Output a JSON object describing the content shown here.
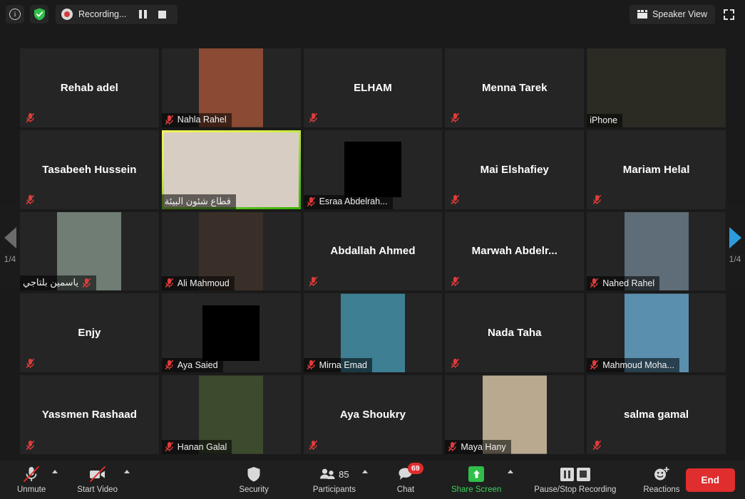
{
  "topbar": {
    "info_icon": "info-icon",
    "shield_icon": "shield-icon",
    "recording_label": "Recording...",
    "pause_recording_icon": "pause-icon",
    "stop_recording_icon": "stop-icon",
    "view_button_label": "Speaker View",
    "view_icon": "grid-view-icon",
    "fullscreen_icon": "fullscreen-icon"
  },
  "gallery": {
    "prev_page_label": "1/4",
    "next_page_label": "1/4",
    "prev_icon": "chevron-left-icon",
    "next_icon": "chevron-right-icon",
    "mute_icon": "microphone-muted-icon",
    "participants": [
      {
        "name": "Rehab adel",
        "video": false,
        "muted": true,
        "name_position": "center"
      },
      {
        "name": "Nahla Rahel",
        "video": true,
        "muted": true,
        "name_position": "bar",
        "avatar": "#8a4a33"
      },
      {
        "name": "ELHAM",
        "video": false,
        "muted": true,
        "name_position": "center"
      },
      {
        "name": "Menna Tarek",
        "video": false,
        "muted": true,
        "name_position": "center"
      },
      {
        "name": "iPhone",
        "video": true,
        "muted": false,
        "name_position": "bar",
        "avatar": "#2b2b24",
        "wide": true
      },
      {
        "name": "Tasabeeh Hussein",
        "video": false,
        "muted": true,
        "name_position": "center"
      },
      {
        "name": "قطاع شئون البيئة",
        "video": true,
        "muted": false,
        "name_position": "bar",
        "active": true,
        "rtl": true,
        "avatar": "#d8cdc2",
        "wide": true
      },
      {
        "name": "Esraa Abdelrah...",
        "video": true,
        "muted": true,
        "name_position": "bar",
        "avatar": "#000000",
        "black": true
      },
      {
        "name": "Mai Elshafiey",
        "video": false,
        "muted": true,
        "name_position": "center"
      },
      {
        "name": "Mariam Helal",
        "video": false,
        "muted": true,
        "name_position": "center"
      },
      {
        "name": "ياسمين بلتاجي",
        "video": true,
        "muted": true,
        "name_position": "bar",
        "rtl": true,
        "avatar": "#6f7d74"
      },
      {
        "name": "Ali Mahmoud",
        "video": true,
        "muted": true,
        "name_position": "bar",
        "avatar": "#3a2f28"
      },
      {
        "name": "Abdallah Ahmed",
        "video": false,
        "muted": true,
        "name_position": "center"
      },
      {
        "name": "Marwah  Abdelr...",
        "video": false,
        "muted": true,
        "name_position": "center"
      },
      {
        "name": "Nahed Rahel",
        "video": true,
        "muted": true,
        "name_position": "bar",
        "avatar": "#5e6d78"
      },
      {
        "name": "Enjy",
        "video": false,
        "muted": true,
        "name_position": "center"
      },
      {
        "name": "Aya Saied",
        "video": true,
        "muted": true,
        "name_position": "bar",
        "avatar": "#000000",
        "black": true
      },
      {
        "name": "Mirna Emad",
        "video": true,
        "muted": true,
        "name_position": "bar",
        "avatar": "#3f7f94"
      },
      {
        "name": "Nada Taha",
        "video": false,
        "muted": true,
        "name_position": "center"
      },
      {
        "name": "Mahmoud Moha...",
        "video": true,
        "muted": true,
        "name_position": "bar",
        "avatar": "#5b8fae"
      },
      {
        "name": "Yassmen Rashaad",
        "video": false,
        "muted": true,
        "name_position": "center"
      },
      {
        "name": "Hanan Galal",
        "video": true,
        "muted": true,
        "name_position": "bar",
        "avatar": "#3c4a2e"
      },
      {
        "name": "Aya Shoukry",
        "video": false,
        "muted": true,
        "name_position": "center"
      },
      {
        "name": "Maya Hany",
        "video": true,
        "muted": true,
        "name_position": "bar",
        "avatar": "#b9a98f"
      },
      {
        "name": "salma gamal",
        "video": false,
        "muted": true,
        "name_position": "center"
      }
    ]
  },
  "toolbar": {
    "unmute_label": "Unmute",
    "unmute_icon": "microphone-muted-icon",
    "start_video_label": "Start Video",
    "start_video_icon": "video-off-icon",
    "security_label": "Security",
    "security_icon": "shield-icon",
    "participants_label": "Participants",
    "participants_icon": "people-icon",
    "participants_count": "85",
    "chat_label": "Chat",
    "chat_icon": "chat-bubble-icon",
    "chat_badge": "69",
    "share_screen_label": "Share Screen",
    "share_screen_icon": "share-arrow-up-icon",
    "recording_label": "Pause/Stop Recording",
    "pause_icon": "pause-icon",
    "stop_icon": "stop-icon",
    "reactions_label": "Reactions",
    "reactions_icon": "smiley-plus-icon",
    "end_label": "End"
  },
  "colors": {
    "accent_green": "#2fbf4a",
    "danger_red": "#e02d2d",
    "active_speaker": "#8fd400",
    "next_arrow_blue": "#2d9cdb"
  }
}
